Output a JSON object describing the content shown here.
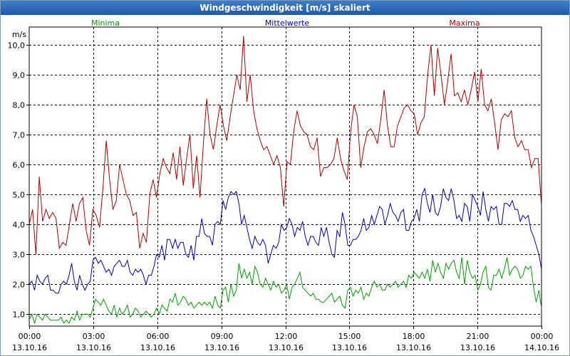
{
  "window_title": "Windgeschwindigkeit [m/s] skaliert",
  "chart_data": {
    "type": "line",
    "title": "Windgeschwindigkeit [m/s] skaliert",
    "ylabel": "m/s",
    "ylim": [
      0.6,
      10.6
    ],
    "xlim": [
      0,
      24
    ],
    "grid": true,
    "y_ticks": [
      "1,0",
      "2,0",
      "3,0",
      "4,0",
      "5,0",
      "6,0",
      "7,0",
      "8,0",
      "9,0",
      "10,0"
    ],
    "x_ticks": [
      {
        "time": "00:00",
        "date": "13.10.16"
      },
      {
        "time": "03:00",
        "date": "13.10.16"
      },
      {
        "time": "06:00",
        "date": "13.10.16"
      },
      {
        "time": "09:00",
        "date": "13.10.16"
      },
      {
        "time": "12:00",
        "date": "13.10.16"
      },
      {
        "time": "15:00",
        "date": "13.10.16"
      },
      {
        "time": "18:00",
        "date": "13.10.16"
      },
      {
        "time": "21:00",
        "date": "13.10.16"
      },
      {
        "time": "00:00",
        "date": "14.10.16"
      }
    ],
    "colors": {
      "minima": "#00a000",
      "mittel": "#0000b0",
      "maxima": "#b00000"
    },
    "series": [
      {
        "name": "Minima",
        "color": "#00a000",
        "values": [
          0.8,
          1.0,
          0.7,
          1.0,
          0.9,
          0.8,
          1.0,
          0.9,
          0.8,
          0.8,
          0.8,
          0.8,
          0.9,
          0.7,
          0.8,
          0.7,
          0.9,
          0.8,
          1.1,
          0.8,
          1.0,
          1.0,
          1.0,
          0.9,
          1.2,
          1.5,
          1.4,
          1.3,
          1.5,
          1.3,
          1.1,
          1.0,
          1.3,
          0.9,
          1.2,
          1.0,
          1.1,
          1.3,
          0.9,
          1.0,
          1.2,
          1.1,
          0.9,
          1.0,
          1.1,
          1.0,
          0.9,
          1.0,
          1.2,
          1.0,
          1.3,
          1.2,
          1.1,
          1.5,
          1.4,
          1.7,
          1.3,
          1.4,
          1.6,
          1.5,
          1.3,
          1.4,
          1.2,
          1.3,
          1.4,
          1.3,
          1.4,
          1.3,
          1.4,
          1.2,
          1.6,
          1.3,
          1.2,
          1.8,
          1.9,
          1.4,
          2.0,
          1.6,
          1.8,
          2.7,
          2.2,
          2.5,
          2.2,
          2.4,
          2.0,
          2.6,
          2.4,
          2.0,
          1.9,
          2.2,
          2.0,
          1.8,
          2.1,
          1.9,
          2.0,
          1.7,
          1.8,
          2.0,
          1.5,
          1.9,
          2.0,
          2.2,
          2.4,
          1.9,
          1.8,
          1.7,
          1.6,
          1.7,
          1.5,
          1.5,
          1.4,
          1.4,
          1.5,
          1.6,
          1.7,
          1.4,
          1.5,
          1.6,
          1.3,
          1.2,
          1.8,
          1.9,
          1.6,
          1.8,
          1.7,
          1.9,
          1.5,
          1.7,
          1.6,
          1.9,
          2.1,
          1.9,
          2.0,
          1.8,
          1.8,
          2.0,
          1.9,
          2.0,
          2.1,
          1.9,
          2.0,
          2.1,
          1.9,
          2.3,
          2.2,
          2.4,
          2.3,
          2.2,
          2.4,
          2.2,
          2.5,
          2.1,
          2.8,
          2.4,
          2.7,
          2.4,
          2.2,
          2.7,
          2.5,
          2.7,
          2.8,
          2.4,
          2.2,
          2.9,
          2.0,
          2.8,
          2.4,
          2.2,
          2.3,
          1.8,
          2.0,
          2.4,
          2.6,
          1.9,
          1.8,
          2.3,
          2.3,
          2.5,
          2.2,
          2.5,
          2.9,
          2.3,
          2.5,
          2.6,
          2.5,
          2.2,
          2.3,
          2.6,
          2.5,
          2.6,
          1.9,
          1.4,
          1.8,
          1.2
        ]
      },
      {
        "name": "Mittelwerte",
        "color": "#0000b0",
        "values": [
          2.0,
          2.1,
          1.8,
          2.3,
          2.1,
          2.0,
          2.2,
          2.3,
          1.8,
          1.8,
          1.7,
          1.7,
          2.0,
          2.1,
          2.0,
          2.3,
          2.7,
          2.1,
          1.8,
          2.3,
          2.0,
          1.8,
          2.0,
          2.1,
          2.8,
          2.9,
          2.7,
          2.8,
          2.6,
          2.4,
          2.5,
          2.3,
          2.6,
          2.7,
          2.8,
          2.6,
          2.6,
          2.8,
          2.4,
          2.3,
          2.5,
          2.4,
          2.5,
          2.3,
          2.0,
          2.3,
          2.3,
          2.6,
          3.0,
          2.9,
          3.3,
          2.8,
          3.5,
          3.5,
          3.2,
          3.5,
          3.2,
          3.4,
          3.4,
          3.0,
          2.9,
          3.3,
          2.8,
          3.6,
          3.6,
          4.2,
          3.7,
          3.6,
          3.6,
          3.3,
          4.0,
          4.1,
          4.0,
          4.8,
          4.5,
          4.9,
          5.1,
          5.0,
          5.1,
          4.7,
          4.0,
          4.3,
          3.9,
          3.5,
          3.2,
          3.6,
          3.4,
          3.3,
          3.5,
          3.3,
          2.7,
          3.0,
          3.3,
          3.2,
          3.4,
          4.0,
          3.8,
          3.9,
          4.2,
          4.0,
          3.6,
          3.9,
          3.8,
          4.1,
          3.6,
          3.3,
          3.6,
          3.6,
          3.4,
          3.3,
          3.9,
          3.6,
          3.9,
          3.4,
          3.0,
          2.9,
          3.8,
          3.6,
          4.4,
          4.0,
          3.3,
          3.3,
          3.5,
          3.5,
          3.6,
          3.8,
          4.2,
          3.8,
          3.9,
          4.3,
          4.0,
          4.3,
          4.6,
          4.5,
          4.0,
          4.3,
          4.7,
          4.4,
          4.3,
          4.1,
          4.4,
          4.5,
          3.8,
          3.8,
          4.1,
          4.2,
          4.5,
          4.1,
          5.0,
          5.2,
          4.7,
          4.4,
          5.0,
          4.4,
          4.3,
          4.6,
          5.2,
          4.9,
          4.8,
          5.2,
          4.8,
          4.2,
          4.3,
          4.1,
          4.7,
          4.6,
          4.1,
          5.0,
          4.8,
          4.6,
          4.3,
          5.1,
          4.5,
          4.1,
          4.6,
          4.5,
          4.6,
          4.0,
          4.0,
          4.7,
          4.7,
          4.6,
          4.8,
          4.5,
          4.5,
          4.1,
          4.3,
          4.2,
          4.3,
          3.8,
          3.6,
          3.3,
          3.0,
          2.5
        ]
      },
      {
        "name": "Maxima",
        "color": "#b00000",
        "values": [
          4.0,
          4.5,
          3.0,
          5.6,
          4.1,
          4.5,
          4.2,
          4.4,
          4.2,
          3.2,
          3.4,
          3.3,
          4.0,
          4.7,
          4.1,
          4.7,
          4.9,
          3.8,
          3.3,
          4.5,
          4.3,
          3.9,
          5.2,
          6.8,
          5.5,
          4.5,
          4.8,
          6.0,
          5.5,
          5.0,
          4.8,
          4.3,
          4.4,
          3.2,
          3.7,
          3.4,
          5.0,
          5.5,
          4.9,
          5.7,
          6.2,
          5.9,
          5.7,
          6.4,
          5.5,
          6.6,
          5.3,
          6.2,
          7.0,
          5.2,
          6.3,
          4.9,
          6.7,
          8.2,
          7.0,
          6.5,
          7.3,
          8.0,
          7.3,
          6.8,
          7.6,
          8.3,
          9.0,
          8.5,
          10.3,
          8.1,
          9.0,
          7.8,
          7.2,
          6.8,
          6.5,
          6.6,
          6.3,
          6.0,
          6.3,
          5.9,
          4.6,
          6.1,
          6.0,
          7.1,
          7.8,
          7.3,
          7.1,
          7.0,
          6.6,
          6.5,
          6.9,
          5.6,
          5.9,
          5.9,
          6.0,
          6.2,
          6.9,
          6.2,
          5.8,
          5.5,
          7.1,
          8.0,
          7.6,
          5.9,
          6.6,
          7.1,
          7.2,
          7.0,
          6.7,
          7.5,
          8.5,
          7.3,
          6.6,
          6.6,
          7.3,
          7.6,
          7.9,
          8.0,
          7.8,
          7.7,
          7.0,
          7.4,
          7.6,
          9.0,
          10.0,
          8.3,
          9.9,
          9.0,
          8.0,
          8.8,
          9.7,
          8.3,
          8.4,
          8.1,
          8.5,
          8.0,
          8.5,
          9.1,
          8.1,
          9.2,
          8.0,
          7.8,
          8.2,
          7.4,
          6.5,
          7.5,
          7.7,
          7.6,
          7.8,
          6.9,
          6.6,
          6.8,
          6.5,
          6.5,
          5.9,
          6.2,
          6.2,
          4.6
        ]
      }
    ]
  }
}
